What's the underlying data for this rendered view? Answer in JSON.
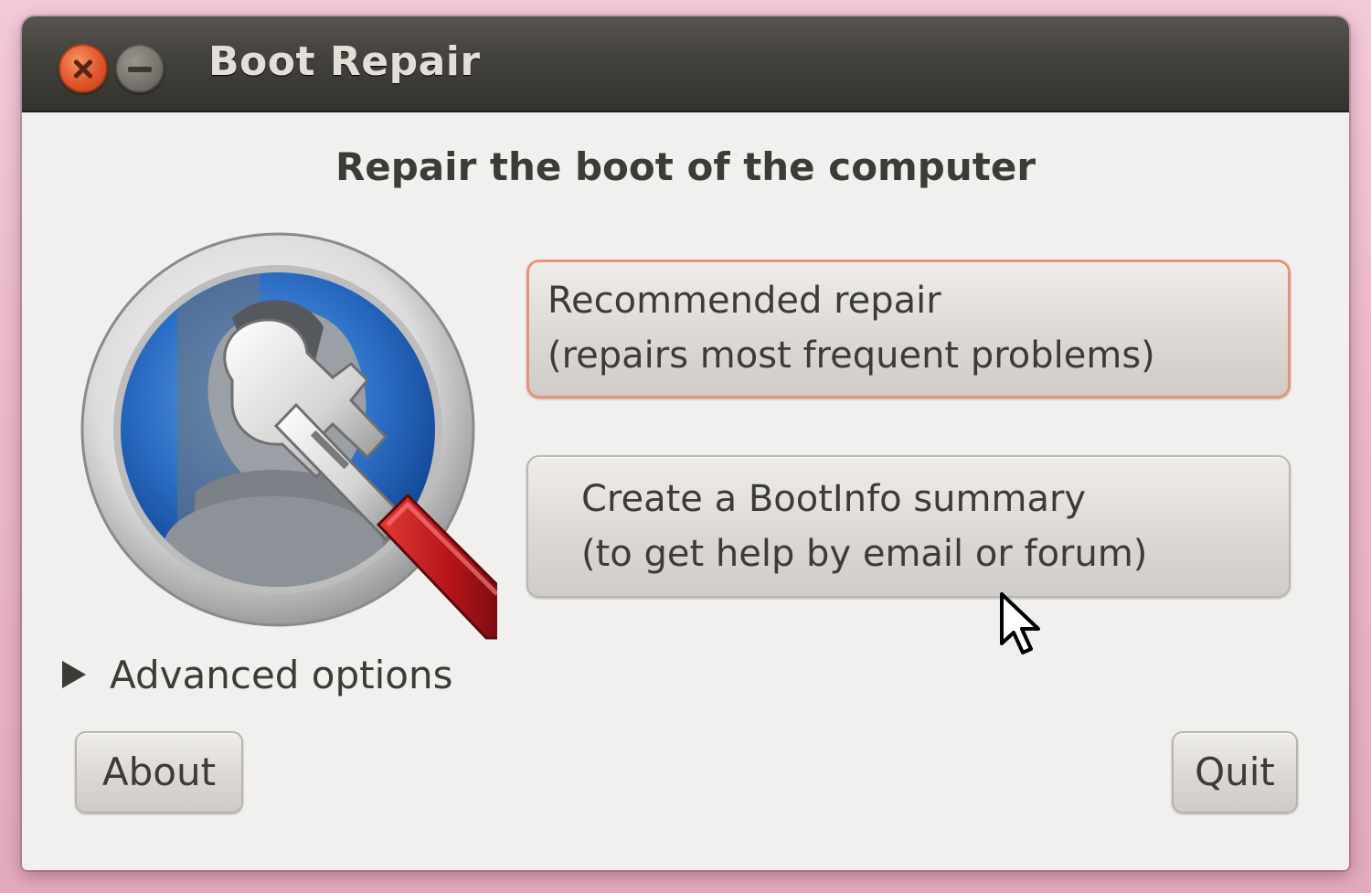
{
  "window": {
    "title": "Boot Repair"
  },
  "main": {
    "heading": "Repair the boot of the computer",
    "recommended_repair": {
      "line1": "Recommended repair",
      "line2": "(repairs most frequent problems)"
    },
    "create_bootinfo": {
      "line1": "Create a BootInfo summary",
      "line2": "(to get help by email or forum)"
    },
    "advanced_options_label": "Advanced options"
  },
  "footer": {
    "about_label": "About",
    "quit_label": "Quit"
  },
  "icons": {
    "close": "close-icon",
    "minimize": "minimize-icon",
    "logo": "boot-repair-logo-icon",
    "expander": "expander-arrow-icon",
    "cursor": "mouse-pointer-icon"
  },
  "colors": {
    "titlebar": "#3c3b37",
    "close_button": "#e2572a",
    "focus_border": "#e8927c",
    "window_bg": "#f2f0ee",
    "text": "#3c3b37"
  }
}
